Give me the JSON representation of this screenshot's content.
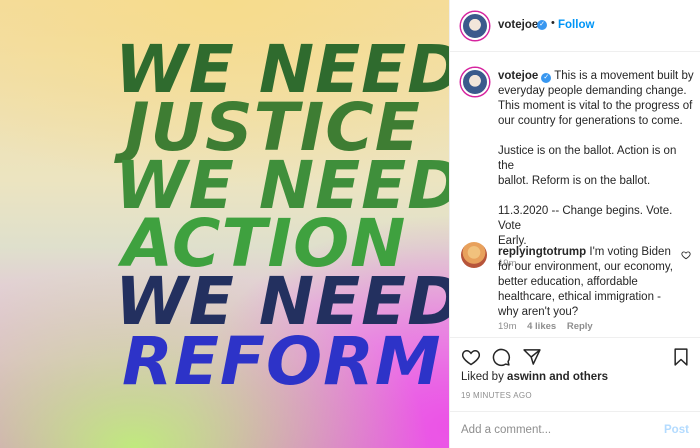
{
  "post_image": {
    "lines": [
      {
        "text": "WE NEED",
        "color": "#2f6b2e"
      },
      {
        "text": "JUSTICE",
        "color": "#3e7d33"
      },
      {
        "text": "WE NEED",
        "color": "#3f8f3b"
      },
      {
        "text": "ACTION",
        "color": "#3fa13f"
      },
      {
        "text": "WE NEED",
        "color": "#23305f"
      },
      {
        "text": "REFORM",
        "color": "#2d33c8"
      }
    ]
  },
  "header": {
    "username": "votejoe",
    "separator": "•",
    "follow_label": "Follow"
  },
  "caption": {
    "username": "votejoe",
    "lines": [
      "This is a movement built by",
      "everyday people demanding change.",
      "This moment is vital to the progress of",
      "our country for generations to come.",
      "",
      "Justice is on the ballot. Action is on the",
      "ballot. Reform is on the ballot.",
      "",
      "11.3.2020 -- Change begins. Vote. Vote",
      "Early."
    ],
    "time": "19m"
  },
  "comment": {
    "username": "replyingtotrump",
    "lines": [
      "I'm voting Biden",
      "for our environment, our economy,",
      "better education, affordable",
      "healthcare, ethical immigration -",
      "why aren't you?"
    ],
    "time": "19m",
    "likes": "4 likes",
    "reply_label": "Reply"
  },
  "actions": {
    "liked_by_prefix": "Liked by",
    "liked_by_user": "aswinn",
    "liked_by_and": "and",
    "liked_by_others": "others",
    "post_time": "19 MINUTES AGO"
  },
  "add_comment": {
    "placeholder": "Add a comment...",
    "post_label": "Post"
  },
  "colors": {
    "accent": "#0095f6",
    "verified": "#3897f0",
    "post_disabled": "#b3dbff"
  }
}
